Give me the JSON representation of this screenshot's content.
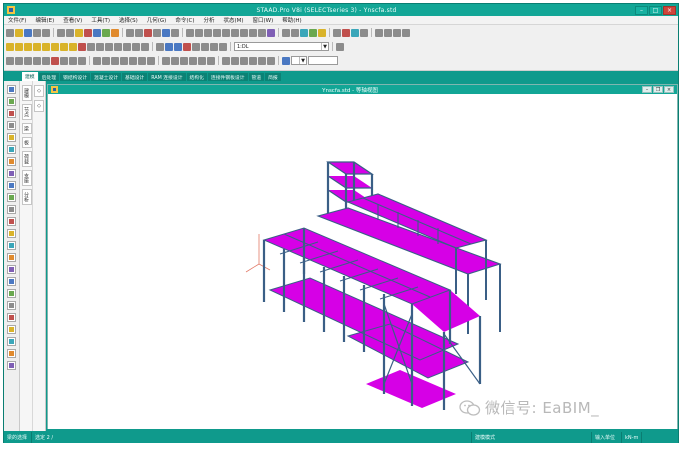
{
  "window": {
    "title": "STAAD.Pro V8i (SELECTseries 3) - Ynscfa.std"
  },
  "menu": [
    "文件(F)",
    "编辑(E)",
    "查看(V)",
    "工具(T)",
    "选择(S)",
    "几何(G)",
    "命令(C)",
    "分析",
    "状态(M)",
    "窗口(W)",
    "帮助(H)"
  ],
  "toolbar": {
    "load_combo": "1:DL"
  },
  "tabs": [
    "建模",
    "后处理",
    "钢结构设计",
    "混凝土设计",
    "基础设计",
    "RAM 连接设计",
    "结构化",
    "连接件钢板设计",
    "管道",
    "简报"
  ],
  "side_tabs": [
    "建模",
    "节点",
    "梁",
    "板",
    "荷载",
    "支座",
    "分析"
  ],
  "document": {
    "title": "Ynscfa.std - 等轴视图"
  },
  "watermark": {
    "text": "微信号: EaBIM_"
  },
  "status": {
    "left": "梁的选择",
    "left2": "选定 2 /",
    "middle": "建模模式",
    "right1": "输入单位",
    "right2": "kN-m"
  },
  "colors": {
    "accent": "#0f9a8c",
    "slab": "#d600e6",
    "frame": "#3a5f86"
  }
}
